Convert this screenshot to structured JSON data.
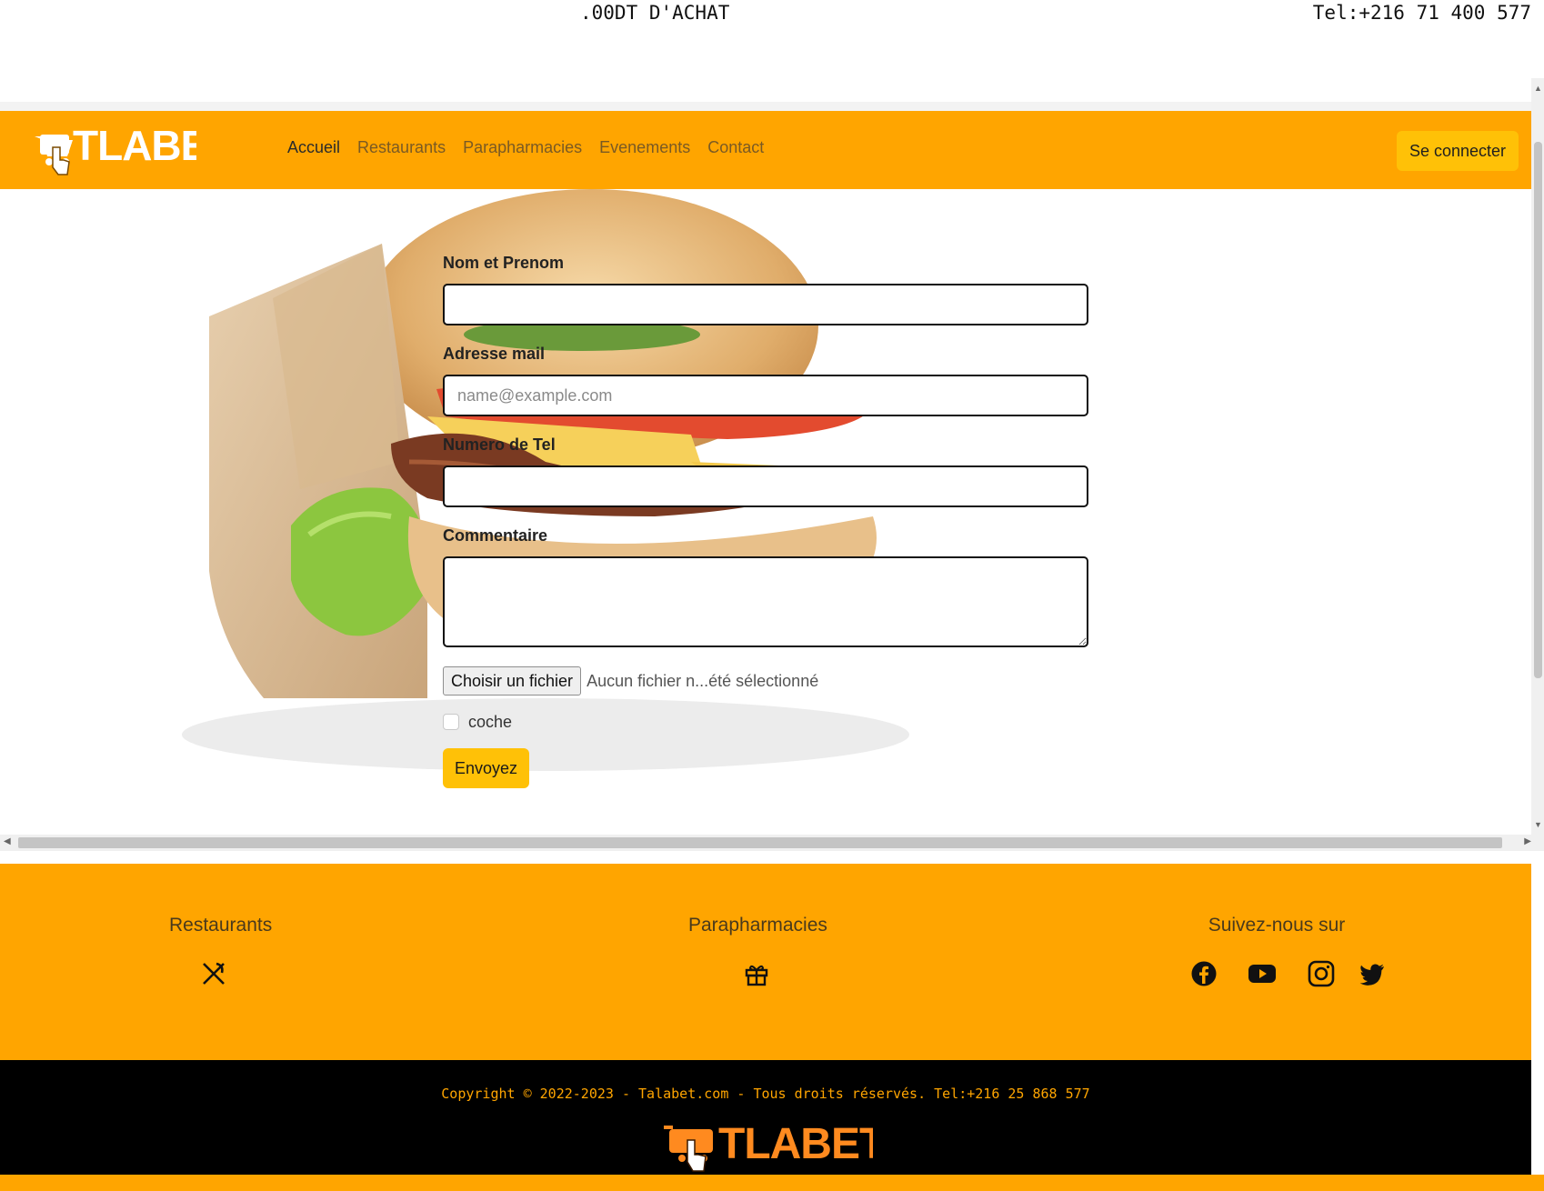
{
  "top": {
    "marquee": ".00DT D'ACHAT",
    "tel": "Tel:+216 71 400 577"
  },
  "brand": {
    "logo_text": "TLABET",
    "accent": "#ffa500",
    "button": "#ffc107"
  },
  "nav": {
    "items": [
      {
        "label": "Accueil",
        "active": true
      },
      {
        "label": "Restaurants"
      },
      {
        "label": "Parapharmacies"
      },
      {
        "label": "Evenements"
      },
      {
        "label": "Contact"
      }
    ],
    "login_label": "Se connecter"
  },
  "form": {
    "name_label": "Nom et Prenom",
    "name_value": "",
    "email_label": "Adresse mail",
    "email_placeholder": "name@example.com",
    "phone_label": "Numero de Tel",
    "phone_value": "",
    "comment_label": "Commentaire",
    "file_button": "Choisir un fichier",
    "file_status": "Aucun fichier n...été sélectionné",
    "checkbox_label": "coche",
    "checkbox_checked": false,
    "submit_label": "Envoyez"
  },
  "footer": {
    "col1_title": "Restaurants",
    "col1_icon": "utensils-icon",
    "col2_title": "Parapharmacies",
    "col2_icon": "gift-icon",
    "col3_title": "Suivez-nous sur",
    "social_icons": [
      "facebook-icon",
      "youtube-icon",
      "instagram-icon",
      "twitter-icon"
    ],
    "copyright": "Copyright © 2022-2023 - Talabet.com - Tous droits réservés. Tel:+216 25 868 577"
  }
}
